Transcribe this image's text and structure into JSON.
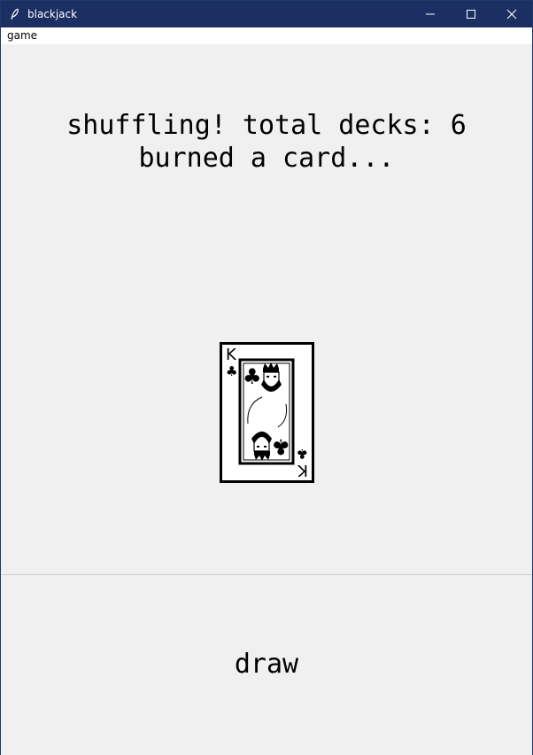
{
  "window": {
    "title": "blackjack",
    "titlebar_color": "#1b2f63",
    "icons": {
      "app": "feather-icon",
      "minimize": "minimize-icon",
      "maximize": "maximize-icon",
      "close": "close-icon"
    }
  },
  "menubar": {
    "items": [
      {
        "label": "game"
      }
    ]
  },
  "status": {
    "line1": "shuffling! total decks: 6",
    "line2": "burned a card..."
  },
  "card": {
    "rank": "K",
    "suit": "clubs",
    "suit_symbol": "♣"
  },
  "actions": {
    "draw_label": "draw"
  }
}
